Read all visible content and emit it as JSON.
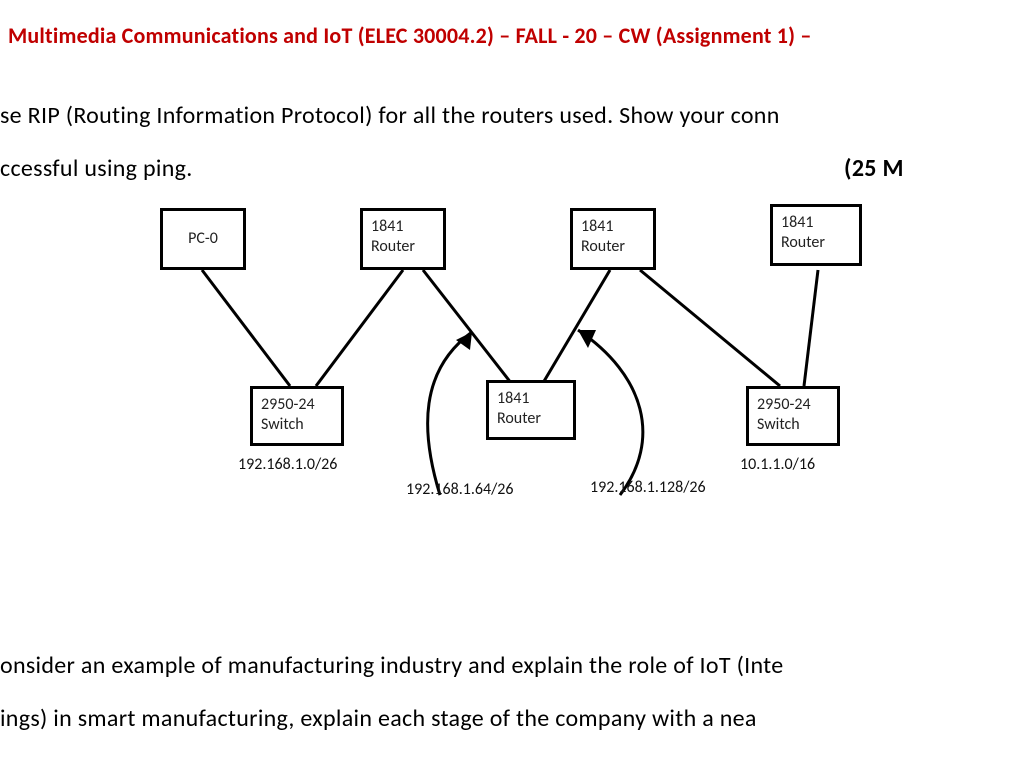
{
  "title": "Multimedia Communications and IoT (ELEC 30004.2) – FALL - 20 – CW (Assignment 1) –",
  "body": {
    "line1": "se RIP (Routing Information Protocol) for all the routers used. Show your conn",
    "line2a": "ccessful using ping.",
    "line2b": "(25 M"
  },
  "diagram": {
    "nodes": {
      "pc0": "PC-0",
      "router_tl": {
        "l1": "1841",
        "l2": "Router"
      },
      "router_tm": {
        "l1": "1841",
        "l2": "Router"
      },
      "router_tr": {
        "l1": "1841",
        "l2": "Router"
      },
      "switch_left": {
        "l1": "2950-24",
        "l2": "Switch"
      },
      "router_bm": {
        "l1": "1841",
        "l2": "Router"
      },
      "switch_right": {
        "l1": "2950-24",
        "l2": "Switch"
      }
    },
    "subnets": {
      "a": "192.168.1.0/26",
      "b": "192.168.1.64/26",
      "c": "192.168.1.128/26",
      "d": "10.1.1.0/16"
    }
  },
  "body2": {
    "line1": "onsider an example of manufacturing industry and explain the role of IoT (Inte",
    "line2": "ings) in smart manufacturing, explain each stage of the company with a nea"
  }
}
